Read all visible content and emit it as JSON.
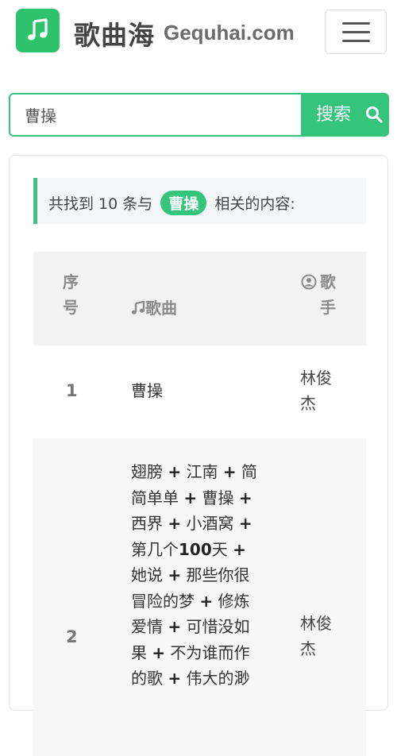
{
  "brand": {
    "name_cn": "歌曲海",
    "name_en": "Gequhai.com"
  },
  "search": {
    "value": "曹操",
    "button_label": "搜索"
  },
  "notice": {
    "prefix": "共找到 10 条与",
    "keyword": "曹操",
    "suffix": "相关的内容:"
  },
  "table": {
    "headers": {
      "index": "序号",
      "song": "歌曲",
      "singer": "歌手"
    },
    "rows": [
      {
        "index": "1",
        "song_lines": [
          "曹操"
        ],
        "singer_lines": [
          "林俊",
          "杰"
        ]
      },
      {
        "index": "2",
        "song_lines": [
          "翅膀 + 江南 + 简",
          "简单单 + 曹操 +",
          "西界 + 小酒窝 +",
          "第几个100天 +",
          "她说 + 那些你很",
          "冒险的梦 + 修炼",
          "爱情 + 可惜没如",
          "果 + 不为谁而作",
          "的歌 + 伟大的渺"
        ],
        "singer_lines": [
          "林俊",
          "杰"
        ]
      }
    ]
  },
  "colors": {
    "accent": "#35c47c",
    "logo": "#2fc26c"
  }
}
